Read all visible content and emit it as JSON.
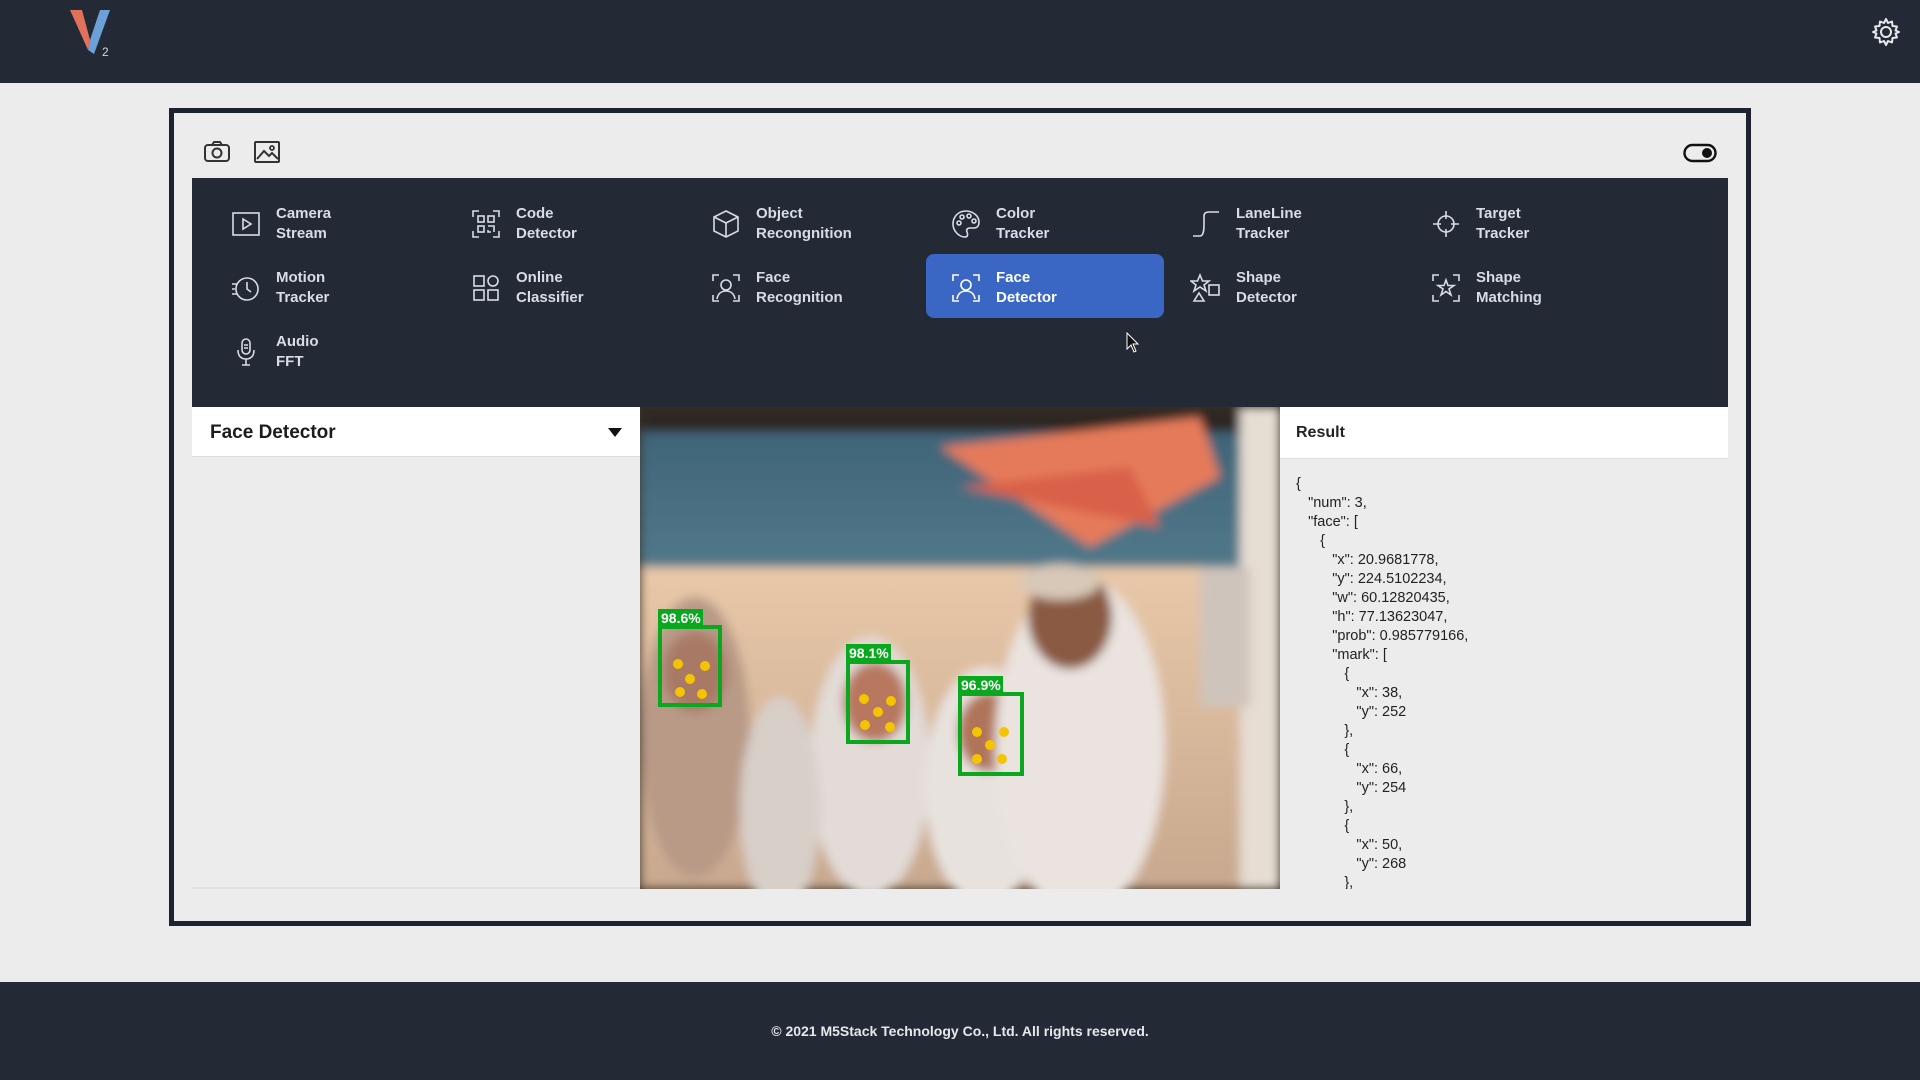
{
  "brand": {
    "logo_text": "V",
    "logo_sub": "2",
    "colors": {
      "dark": "#232a36",
      "accent": "#3a66c4",
      "logo_red": "#e0715a",
      "logo_blue": "#6ea0d8"
    }
  },
  "header": {
    "settings_icon": "gear-icon"
  },
  "toolbar": {
    "camera_icon": "camera-icon",
    "image_icon": "image-icon",
    "toggle_icon": "toggle-switch-icon"
  },
  "menu": {
    "items": [
      {
        "line1": "Camera",
        "line2": "Stream",
        "icon": "play-box-icon",
        "active": false
      },
      {
        "line1": "Code",
        "line2": "Detector",
        "icon": "qr-code-icon",
        "active": false
      },
      {
        "line1": "Object",
        "line2": "Recongnition",
        "icon": "cube-icon",
        "active": false
      },
      {
        "line1": "Color",
        "line2": "Tracker",
        "icon": "palette-icon",
        "active": false
      },
      {
        "line1": "LaneLine",
        "line2": "Tracker",
        "icon": "lane-line-icon",
        "active": false
      },
      {
        "line1": "Target",
        "line2": "Tracker",
        "icon": "crosshair-icon",
        "active": false
      },
      {
        "line1": "Motion",
        "line2": "Tracker",
        "icon": "motion-icon",
        "active": false
      },
      {
        "line1": "Online",
        "line2": "Classifier",
        "icon": "grid-icon",
        "active": false
      },
      {
        "line1": "Face",
        "line2": "Recognition",
        "icon": "face-scan-icon",
        "active": false
      },
      {
        "line1": "Face",
        "line2": "Detector",
        "icon": "face-scan-icon",
        "active": true
      },
      {
        "line1": "Shape",
        "line2": "Detector",
        "icon": "shapes-icon",
        "active": false
      },
      {
        "line1": "Shape",
        "line2": "Matching",
        "icon": "star-scan-icon",
        "active": false
      },
      {
        "line1": "Audio",
        "line2": "FFT",
        "icon": "microphone-icon",
        "active": false
      }
    ]
  },
  "function_panel": {
    "title": "Face Detector"
  },
  "camera": {
    "detections": [
      {
        "label": "98.6%"
      },
      {
        "label": "98.1%"
      },
      {
        "label": "96.9%"
      }
    ]
  },
  "result": {
    "title": "Result",
    "json_text": "{\n   \"num\": 3,\n   \"face\": [\n      {\n         \"x\": 20.9681778,\n         \"y\": 224.5102234,\n         \"w\": 60.12820435,\n         \"h\": 77.13623047,\n         \"prob\": 0.985779166,\n         \"mark\": [\n            {\n               \"x\": 38,\n               \"y\": 252\n            },\n            {\n               \"x\": 66,\n               \"y\": 254\n            },\n            {\n               \"x\": 50,\n               \"y\": 268\n            },"
  },
  "footer": {
    "copyright": "© 2021 M5Stack Technology Co., Ltd. All rights reserved."
  }
}
